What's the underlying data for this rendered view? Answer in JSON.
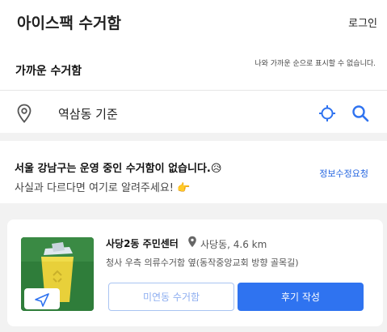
{
  "header": {
    "title": "아이스팩 수거함",
    "login_label": "로그인"
  },
  "nearby": {
    "title": "가까운 수거함",
    "note": "나와 가까운 순으로 표시할 수 없습니다.",
    "location": "역삼동 기준",
    "icons": {
      "pin": "map-pin-icon",
      "locate": "crosshair-icon",
      "search": "search-icon"
    }
  },
  "notice": {
    "main": "서울 강남구는 운영 중인 수거함이 없습니다.",
    "main_emoji": "😥",
    "sub": "사실과 다르다면 여기로 알려주세요!",
    "sub_emoji": "👉",
    "link": "정보수정요청"
  },
  "card": {
    "name": "사당2동 주민센터",
    "location": "사당동, 4.6 km",
    "description": "청사 우측 의류수거함 옆(동작중앙교회 방향 골목길)",
    "unvisited_label": "미연동 수거함",
    "review_label": "후기 작성"
  },
  "colors": {
    "accent": "#2f73f0",
    "link": "#2566e0",
    "thumb_bg": "#2f7d3a"
  }
}
